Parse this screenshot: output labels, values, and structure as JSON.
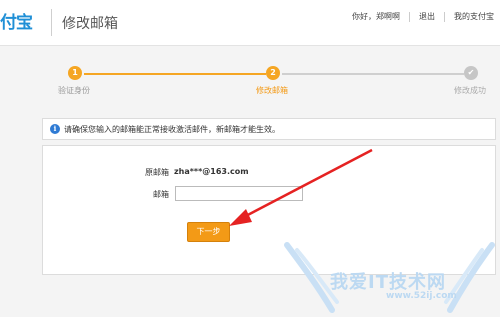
{
  "header": {
    "logo_text": "付宝",
    "page_title": "修改邮箱",
    "nav": {
      "greeting": "你好，郑啊啊",
      "logout": "退出",
      "my_alipay": "我的支付宝"
    }
  },
  "steps": [
    {
      "number": "1",
      "label": "验证身份",
      "state": "done"
    },
    {
      "number": "2",
      "label": "修改邮箱",
      "state": "current"
    },
    {
      "number": "✔",
      "label": "修改成功",
      "state": "pending"
    }
  ],
  "colors": {
    "accent": "#f5a623",
    "button": "#f39a16",
    "inactive": "#cfcfcf",
    "info": "#2f7bd4"
  },
  "notice": {
    "icon": "info-icon",
    "text": "请确保您输入的邮箱能正常接收激活邮件，新邮箱才能生效。"
  },
  "form": {
    "original_email_label": "原邮箱",
    "original_email_value": "zha***@163.com",
    "email_label": "邮箱",
    "email_value": "",
    "next_button": "下一步"
  },
  "watermark": {
    "text": "我爱IT技术网",
    "url": "www.52ij.com"
  }
}
